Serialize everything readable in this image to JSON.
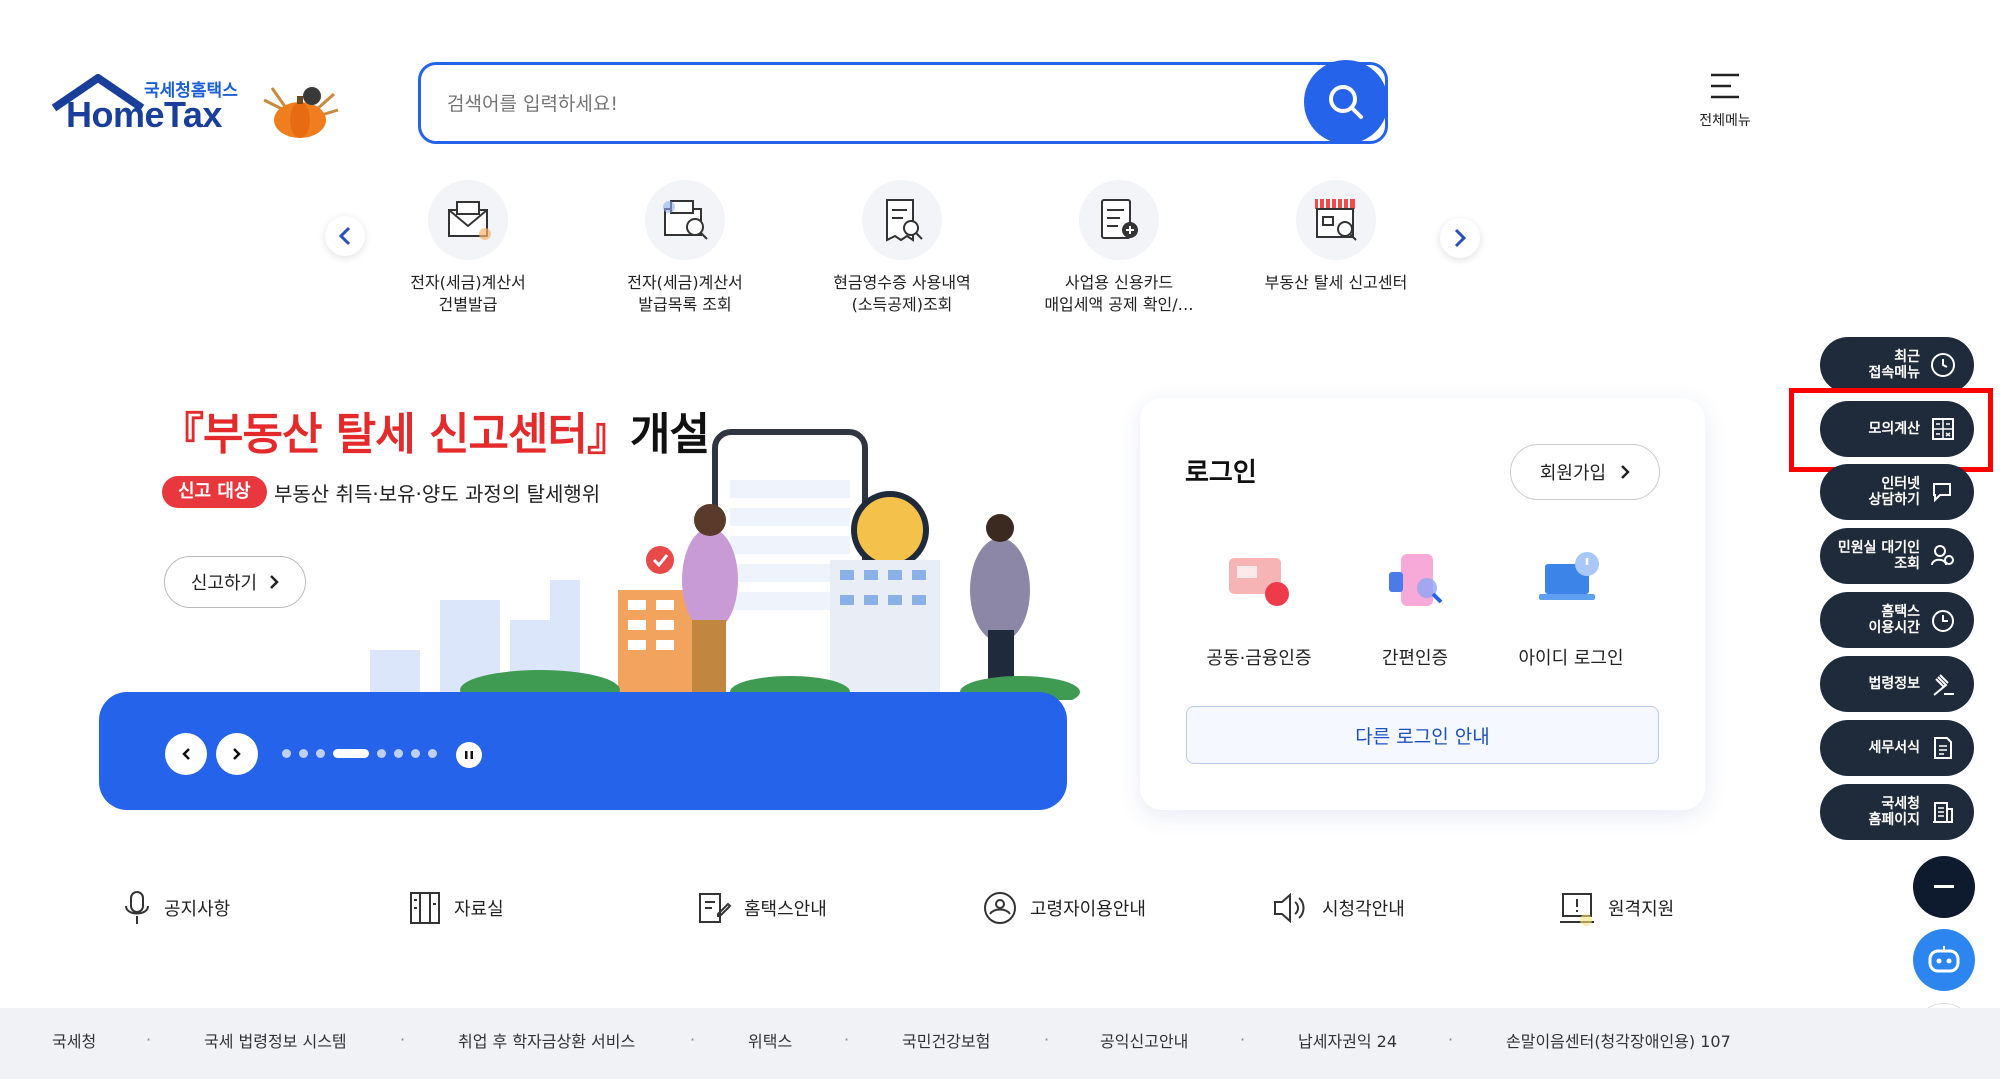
{
  "header": {
    "logo_sub": "국세청홈택스",
    "logo_main": "HomeTax",
    "search_placeholder": "검색어를 입력하세요!",
    "menu_label": "전체메뉴"
  },
  "quick_menu": [
    {
      "label_1": "전자(세금)계산서",
      "label_2": "건별발급",
      "icon": "envelope-tax-icon"
    },
    {
      "label_1": "전자(세금)계산서",
      "label_2": "발급목록 조회",
      "icon": "tax-search-icon"
    },
    {
      "label_1": "현금영수증 사용내역",
      "label_2": "(소득공제)조회",
      "icon": "receipt-search-icon"
    },
    {
      "label_1": "사업용 신용카드",
      "label_2": "매입세액 공제 확인/…",
      "icon": "card-document-icon"
    },
    {
      "label_1": "부동산 탈세 신고센터",
      "label_2": "",
      "icon": "store-search-icon"
    }
  ],
  "banner": {
    "title_red": "『부동산 탈세 신고센터』",
    "title_black": "개설",
    "badge": "신고 대상",
    "desc": "부동산 취득·보유·양도 과정의 탈세행위",
    "cta": "신고하기",
    "slide_count": 8,
    "active_slide": 4
  },
  "login": {
    "title": "로그인",
    "join": "회원가입",
    "methods": [
      {
        "label": "공동·금융인증",
        "icon": "certificate-icon"
      },
      {
        "label": "간편인증",
        "icon": "phone-auth-icon"
      },
      {
        "label": "아이디 로그인",
        "icon": "laptop-login-icon"
      }
    ],
    "other": "다른 로그인 안내"
  },
  "float_menu": [
    {
      "line1": "최근",
      "line2": "접속메뉴",
      "icon": "clock-icon"
    },
    {
      "line1": "모의계산",
      "line2": "",
      "icon": "calculator-icon"
    },
    {
      "line1": "인터넷",
      "line2": "상담하기",
      "icon": "chat-icon"
    },
    {
      "line1": "민원실 대기인",
      "line2": "조회",
      "icon": "person-search-icon"
    },
    {
      "line1": "홈택스",
      "line2": "이용시간",
      "icon": "time-icon"
    },
    {
      "line1": "법령정보",
      "line2": "",
      "icon": "gavel-icon"
    },
    {
      "line1": "세무서식",
      "line2": "",
      "icon": "form-icon"
    },
    {
      "line1": "국세청",
      "line2": "홈페이지",
      "icon": "building-icon"
    }
  ],
  "bottom_links": [
    {
      "label": "공지사항",
      "icon": "microphone-icon"
    },
    {
      "label": "자료실",
      "icon": "archive-icon"
    },
    {
      "label": "홈택스안내",
      "icon": "guide-icon"
    },
    {
      "label": "고령자이용안내",
      "icon": "elderly-icon"
    },
    {
      "label": "시청각안내",
      "icon": "speaker-icon"
    },
    {
      "label": "원격지원",
      "icon": "remote-support-icon"
    }
  ],
  "footer": [
    "국세청",
    "국세 법령정보 시스템",
    "취업 후 학자금상환 서비스",
    "위택스",
    "국민건강보험",
    "공익신고안내",
    "납세자권익 24",
    "손말이음센터(청각장애인용) 107"
  ],
  "colors": {
    "primary": "#2563eb",
    "float_bg": "#1f2b3a",
    "highlight": "#ff0000",
    "badge": "#e8383d"
  }
}
